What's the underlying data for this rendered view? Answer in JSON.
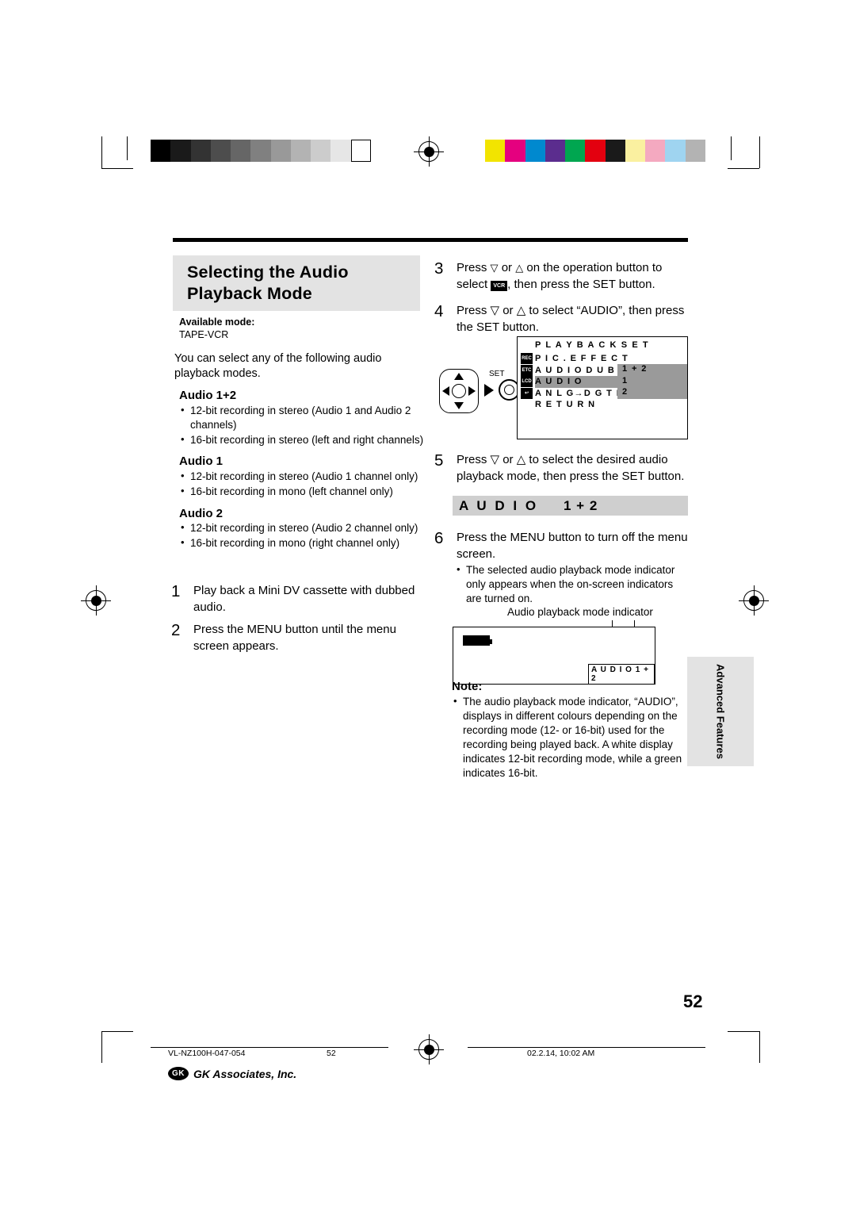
{
  "title": {
    "line1": "Selecting the Audio",
    "line2": "Playback Mode"
  },
  "available": {
    "label": "Available mode:",
    "value": "TAPE-VCR"
  },
  "intro": "You can select any of the following audio playback modes.",
  "sections": [
    {
      "heading": "Audio 1+2",
      "bullets": [
        "12-bit recording in stereo (Audio 1 and Audio 2 channels)",
        "16-bit recording in stereo (left and right channels)"
      ]
    },
    {
      "heading": "Audio 1",
      "bullets": [
        "12-bit recording in stereo (Audio 1 channel only)",
        "16-bit recording in mono (left channel only)"
      ]
    },
    {
      "heading": "Audio 2",
      "bullets": [
        "12-bit recording in stereo (Audio 2 channel only)",
        "16-bit recording in mono (right channel only)"
      ]
    }
  ],
  "steps": [
    {
      "num": "1",
      "text": "Play back a Mini DV cassette with dubbed audio."
    },
    {
      "num": "2",
      "text": "Press the MENU button until the menu screen appears."
    },
    {
      "num": "3",
      "text_a": "Press",
      "text_b": "or",
      "text_c": "on the operation button to select",
      "icon": "VCR",
      "text_d": ", then press the SET button."
    },
    {
      "num": "4",
      "text": "Press ▽ or △ to select “AUDIO”, then press the SET button."
    },
    {
      "num": "5",
      "text": "Press ▽ or △ to select the desired audio playback mode, then press the SET button."
    },
    {
      "num": "6",
      "text": "Press the MENU button to turn off the menu screen.",
      "sub": "The selected audio playback mode indicator only appears when the on-screen indicators are turned on."
    }
  ],
  "osd": {
    "title": "P L A Y B A C K   S E T",
    "rows": [
      "P I C . E F F E C T",
      "A U D I O  D U B",
      "A U D I O",
      "A N L G→D G T L",
      "R E T U R N"
    ],
    "side_tabs": [
      "REC",
      "ETC",
      "LCD",
      "↩"
    ],
    "values": [
      "1 + 2",
      "1",
      "2"
    ],
    "highlight_row_index": 2,
    "highlight_value_index": 0
  },
  "joystick": {
    "set_label": "SET"
  },
  "audio_banner": {
    "left": "A U D I O",
    "right": "1 + 2"
  },
  "indicator": {
    "caption": "Audio playback mode indicator",
    "lcd_text": "A U D I O 1 + 2"
  },
  "note": {
    "label": "Note:",
    "text": "The audio playback mode indicator, “AUDIO”, displays in different colours depending on the recording mode (12- or 16-bit) used for the recording being played back. A white display indicates 12-bit recording mode, while a green indicates 16-bit."
  },
  "side_tab": {
    "label": "Advanced Features"
  },
  "page_number": "52",
  "footer": {
    "left": "VL-NZ100H-047-054",
    "center": "52",
    "right": "02.2.14, 10:02 AM",
    "logo_mark": "GK",
    "logo_name": "GK Associates, Inc."
  },
  "calibration": {
    "grays": [
      "#000000",
      "#1a1a1a",
      "#333333",
      "#4d4d4d",
      "#666666",
      "#808080",
      "#999999",
      "#b3b3b3",
      "#cccccc",
      "#e6e6e6",
      "#ffffff"
    ],
    "colors": [
      "#f2e400",
      "#e5007f",
      "#0089cf",
      "#5b2d8e",
      "#00a650",
      "#e3000f",
      "#1a1a1a",
      "#faf0a0",
      "#f4a9c0",
      "#9fd4f0",
      "#b3b3b3"
    ]
  }
}
